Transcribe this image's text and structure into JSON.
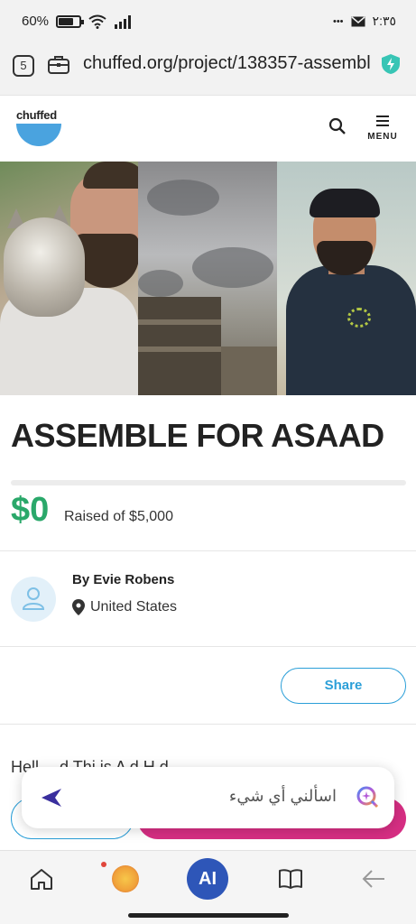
{
  "status_bar": {
    "battery_percent": "60%",
    "time": "٢:٣٥",
    "more": "•••"
  },
  "browser": {
    "tab_count": "5",
    "url": "chuffed.org/project/138357-assembl"
  },
  "site": {
    "logo_text": "chuffed",
    "menu_label": "MENU",
    "brand_color": "#4aa3df"
  },
  "campaign": {
    "title": "ASSEMBLE FOR ASAAD",
    "raised_amount": "$0",
    "raised_label": "Raised of $5,000",
    "progress_fraction": 0,
    "organiser_name": "By Evie Robens",
    "location": "United States",
    "share_label": "Share",
    "body_excerpt": "Hell…              d Thi  is A    d H          d"
  },
  "ai_assistant": {
    "placeholder": "اسألني أي شيء"
  },
  "bottom_nav": {
    "ai_label": "AI"
  },
  "icons": {
    "tabs": "tabs-count-icon",
    "briefcase": "briefcase-icon",
    "shield": "shield-icon",
    "search": "search-icon",
    "menu": "hamburger-menu-icon",
    "avatar": "user-icon",
    "location": "location-pin-icon",
    "send": "send-icon",
    "ask_ai": "ask-ai-icon",
    "home": "home-icon",
    "games": "games-icon",
    "book": "book-icon",
    "back": "back-arrow-icon"
  },
  "colors": {
    "accent_green": "#2aa86a",
    "share_blue": "#2b9fd8",
    "donate_pink": "#d62e83",
    "ai_blue": "#2e56b8"
  }
}
